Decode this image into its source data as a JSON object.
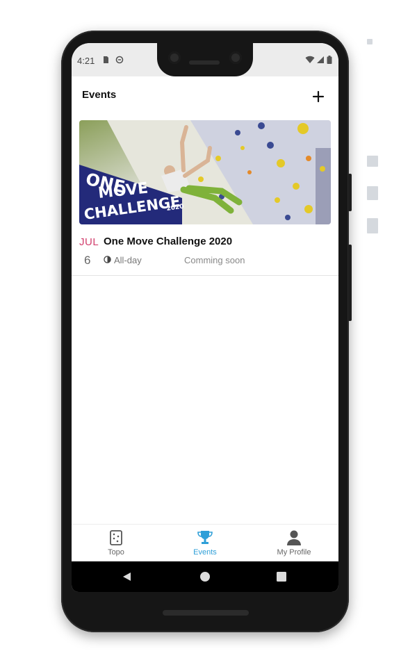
{
  "status_bar": {
    "time": "4:21"
  },
  "header": {
    "title": "Events"
  },
  "events": [
    {
      "month": "JUL",
      "day": "6",
      "title": "One Move Challenge 2020",
      "time": "All-day",
      "status": "Comming soon",
      "image_text": {
        "line1": "ONE",
        "line2": "MOVE",
        "line3": "CHALLENGE",
        "year": "2020"
      }
    }
  ],
  "bottom_nav": [
    {
      "label": "Topo",
      "icon": "topo-icon",
      "active": false
    },
    {
      "label": "Events",
      "icon": "trophy-icon",
      "active": true
    },
    {
      "label": "My Profile",
      "icon": "person-icon",
      "active": false
    }
  ],
  "colors": {
    "accent": "#2e9fd8",
    "month": "#d23f6d",
    "banner": "#232a7a"
  }
}
